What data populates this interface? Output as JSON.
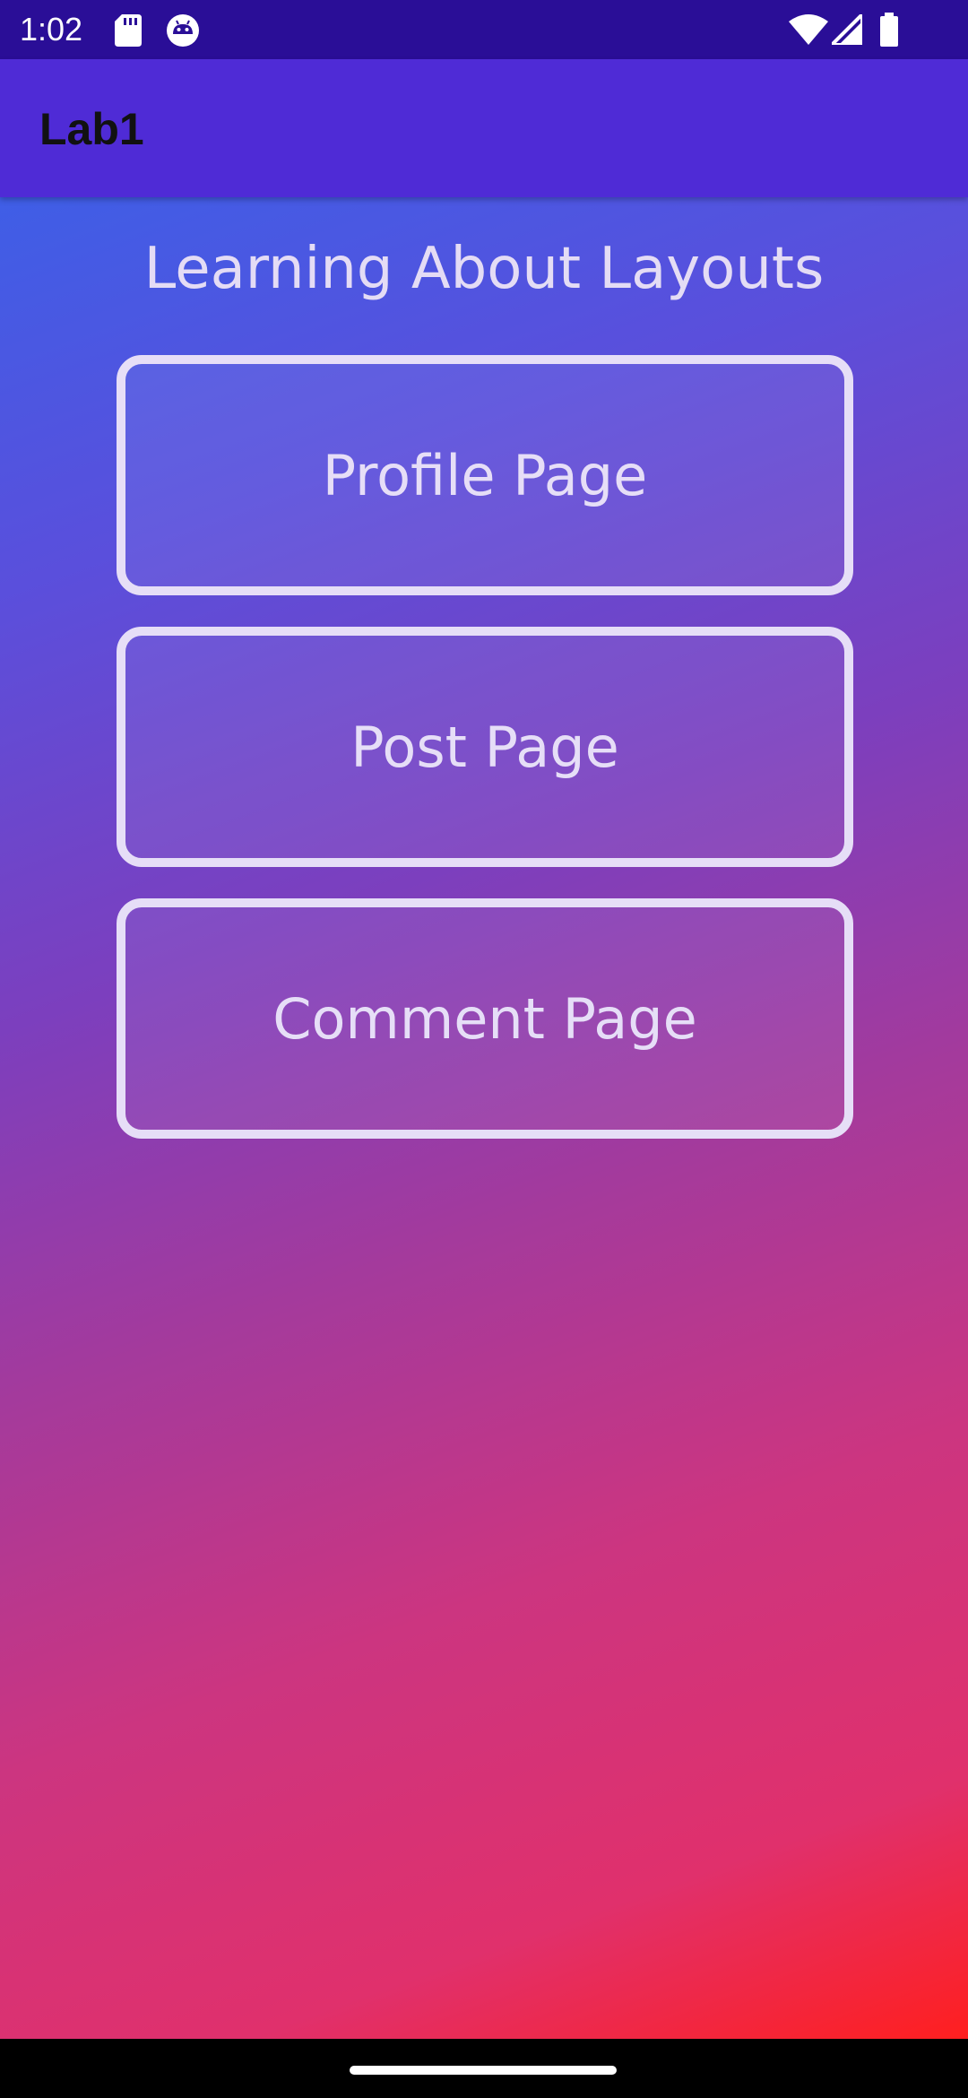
{
  "status_bar": {
    "time": "1:02",
    "icons": [
      "sd-card-icon",
      "android-debug-icon",
      "wifi-icon",
      "cell-signal-icon",
      "battery-icon"
    ]
  },
  "app_bar": {
    "title": "Lab1"
  },
  "main": {
    "title": "Learning About Layouts",
    "buttons": [
      {
        "label": "Profile Page"
      },
      {
        "label": "Post Page"
      },
      {
        "label": "Comment Page"
      }
    ]
  },
  "colors": {
    "status_bar": "#2a0e97",
    "app_bar": "#4f2bd6",
    "gradient_start": "#3f5ee6",
    "gradient_mid": "#a43a9c",
    "gradient_end": "#ff1f1f",
    "button_border": "#e6def7"
  }
}
